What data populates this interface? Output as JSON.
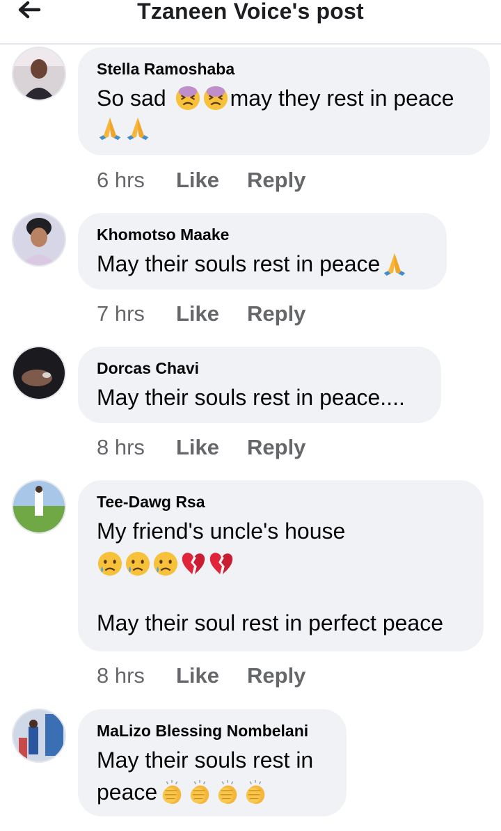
{
  "header": {
    "title": "Tzaneen Voice's post",
    "back_icon": "arrow-left-icon"
  },
  "comments": [
    {
      "author": "Stella Ramoshaba",
      "text_lines": [
        "So sad",
        "may they rest in peace"
      ],
      "emojis": [
        "weary-face",
        "weary-face",
        "folded-hands",
        "folded-hands"
      ],
      "time": "6 hrs",
      "like_label": "Like",
      "reply_label": "Reply"
    },
    {
      "author": "Khomotso Maake",
      "text_lines": [
        "May their souls rest in peace"
      ],
      "emojis": [
        "folded-hands"
      ],
      "time": "7 hrs",
      "like_label": "Like",
      "reply_label": "Reply"
    },
    {
      "author": "Dorcas Chavi",
      "text_lines": [
        "May their souls rest in peace...."
      ],
      "emojis": [],
      "time": "8 hrs",
      "like_label": "Like",
      "reply_label": "Reply"
    },
    {
      "author": "Tee-Dawg Rsa",
      "text_lines": [
        "My friend's uncle's house",
        "May their soul rest in perfect peace"
      ],
      "emojis": [
        "crying-face",
        "crying-face",
        "crying-face",
        "broken-heart",
        "broken-heart"
      ],
      "time": "8 hrs",
      "like_label": "Like",
      "reply_label": "Reply"
    },
    {
      "author": "MaLizo Blessing Nombelani",
      "text_lines": [
        "May their souls rest in",
        "peace"
      ],
      "emojis": [
        "clapping-hands",
        "clapping-hands",
        "clapping-hands",
        "clapping-hands"
      ]
    }
  ]
}
